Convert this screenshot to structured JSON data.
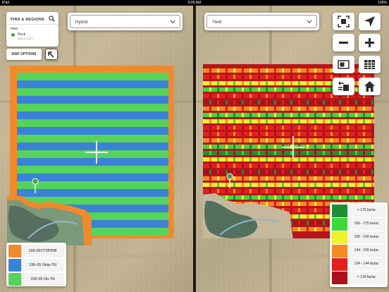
{
  "status_bar": {
    "left": "iPad",
    "time": "8:06 AM",
    "right": "100%"
  },
  "left_pane": {
    "pins_panel": {
      "title": "PINS & REGIONS",
      "section": "PINS",
      "pins": [
        {
          "name": "Rock",
          "date": "May 4, 2017"
        }
      ]
    },
    "map_options_label": "MAP OPTIONS",
    "dropdown_value": "Hybrid",
    "legend": [
      {
        "label": "196-05VT2PRIB",
        "color": "#ef8a2c"
      },
      {
        "label": "196-05 Strip-Till",
        "color": "#3b82d6"
      },
      {
        "label": "196-05 No-Till",
        "color": "#55d35a"
      }
    ]
  },
  "right_pane": {
    "dropdown_value": "Yield",
    "controls": [
      "fit-screen-icon",
      "navigate-arrow-icon",
      "zoom-out-icon",
      "zoom-in-icon",
      "map-layer-icon",
      "table-icon",
      "swap-layers-icon",
      "home-icon"
    ],
    "legend": [
      {
        "label": "> 175 bu/ac",
        "color": "#1e8f35"
      },
      {
        "label": "166 - 175 bu/ac",
        "color": "#3fd83a"
      },
      {
        "label": "155 - 166 bu/ac",
        "color": "#f1f12a"
      },
      {
        "label": "144 - 155 bu/ac",
        "color": "#f58a22"
      },
      {
        "label": "134 - 144 bu/ac",
        "color": "#e3201d"
      },
      {
        "label": "< 134 bu/ac",
        "color": "#a8131b"
      }
    ]
  }
}
